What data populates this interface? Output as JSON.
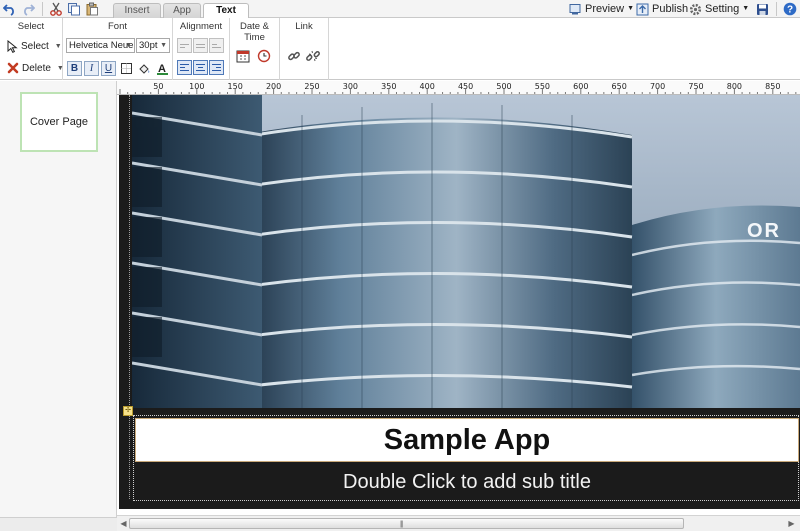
{
  "tabs": [
    {
      "label": "Insert",
      "active": false
    },
    {
      "label": "App",
      "active": false
    },
    {
      "label": "Text",
      "active": true
    }
  ],
  "top_right": {
    "preview": "Preview",
    "publish": "Publish",
    "setting": "Setting"
  },
  "ribbon": {
    "select_group": {
      "title": "Select",
      "select_label": "Select",
      "delete_label": "Delete"
    },
    "font_group": {
      "title": "Font",
      "font_family": "Helvetica Neue",
      "font_size": "30pt",
      "bold": "B",
      "italic": "I",
      "underline": "U"
    },
    "alignment_group": {
      "title": "Alignment"
    },
    "datetime_group": {
      "title": "Date & Time"
    },
    "link_group": {
      "title": "Link"
    }
  },
  "sidebar": {
    "pages": [
      {
        "label": "Cover Page"
      }
    ]
  },
  "ruler": {
    "labels": [
      "50",
      "100",
      "150",
      "200",
      "250",
      "300",
      "350",
      "400",
      "450",
      "500",
      "550",
      "600",
      "650",
      "700",
      "750",
      "800",
      "850"
    ]
  },
  "cover": {
    "title": "Sample App",
    "subtitle": "Double Click to add sub title",
    "photo_sign_text": "OR"
  },
  "colors": {
    "accent": "#2a5aa8",
    "page_bg": "#1b1b1b",
    "thumb_border": "#bde3b4"
  }
}
